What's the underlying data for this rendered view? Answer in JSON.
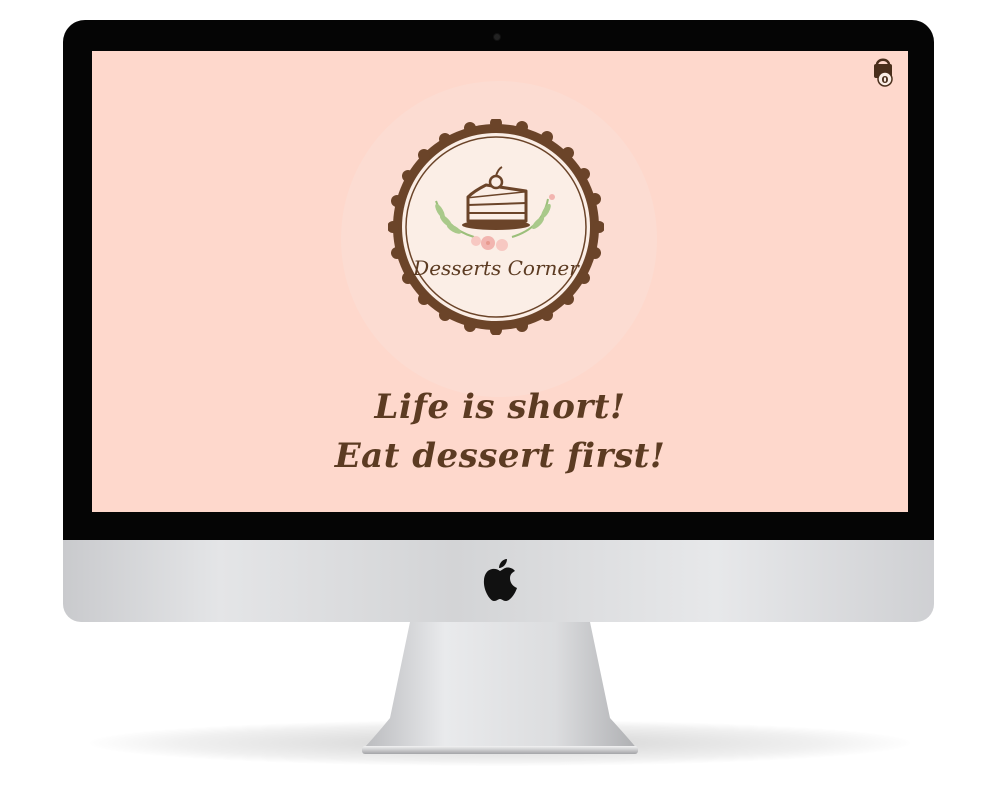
{
  "site": {
    "logo_text": "Desserts Corner",
    "tagline_line1": "Life is short!",
    "tagline_line2": "Eat dessert first!",
    "cart_count": "0",
    "background_color": "#fed8cc",
    "text_color": "#5c3b22"
  },
  "icons": {
    "cart": "shopping-bag-icon",
    "cake": "cake-slice-icon",
    "device_brand": "apple-logo-icon"
  }
}
